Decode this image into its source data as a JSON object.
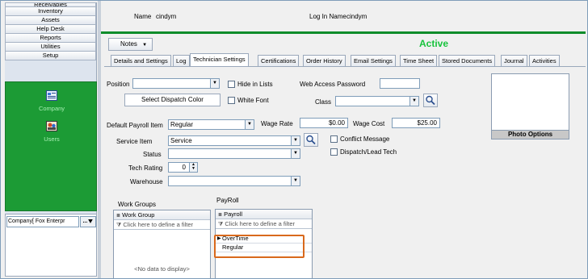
{
  "nav": {
    "items": [
      "Receivables",
      "Inventory",
      "Assets",
      "Help Desk",
      "Reports",
      "Utilities",
      "Setup"
    ],
    "green_items": [
      "Company",
      "Users"
    ],
    "company_field": "Company[ Fox Enterpr",
    "company_button": "..."
  },
  "header": {
    "name_label": "Name",
    "name_value": "cindym",
    "login_label": "Log In Name",
    "login_value": "cindym",
    "notes_button": "Notes",
    "status": "Active"
  },
  "tabs": [
    "Details and Settings",
    "Log",
    "Technician Settings",
    "Certifications",
    "Order History",
    "Email Settings",
    "Time Sheet",
    "Stored Documents",
    "Journal",
    "Activities"
  ],
  "active_tab": "Technician Settings",
  "form": {
    "position_label": "Position",
    "position_value": "",
    "hide_in_lists_label": "Hide in Lists",
    "web_access_password_label": "Web Access Password",
    "web_access_password_value": "",
    "select_dispatch_color_button": "Select Dispatch Color",
    "white_font_label": "White Font",
    "class_label": "Class",
    "class_value": "",
    "default_payroll_item_label": "Default Payroll Item",
    "default_payroll_item_value": "Regular",
    "wage_rate_label": "Wage Rate",
    "wage_rate_value": "$0.00",
    "wage_cost_label": "Wage Cost",
    "wage_cost_value": "$25.00",
    "service_item_label": "Service Item",
    "service_item_value": "Service",
    "conflict_message_label": "Conflict Message",
    "status_label": "Status",
    "status_value": "",
    "dispatch_lead_tech_label": "Dispatch/Lead Tech",
    "tech_rating_label": "Tech Rating",
    "tech_rating_value": "0",
    "warehouse_label": "Warehouse",
    "warehouse_value": "",
    "photo_options_button": "Photo Options"
  },
  "work_groups": {
    "title": "Work Groups",
    "column": "Work Group",
    "filter_placeholder": "Click here to define a filter",
    "empty_text": "<No data to display>"
  },
  "payroll": {
    "title": "PayRoll",
    "column": "Payroll",
    "filter_placeholder": "Click here to define a filter",
    "rows": [
      "OverTime",
      "Regular"
    ],
    "highlight_color": "#d9691c"
  },
  "colors": {
    "status_active": "#17c33c",
    "nav_green": "#1c9b35"
  }
}
